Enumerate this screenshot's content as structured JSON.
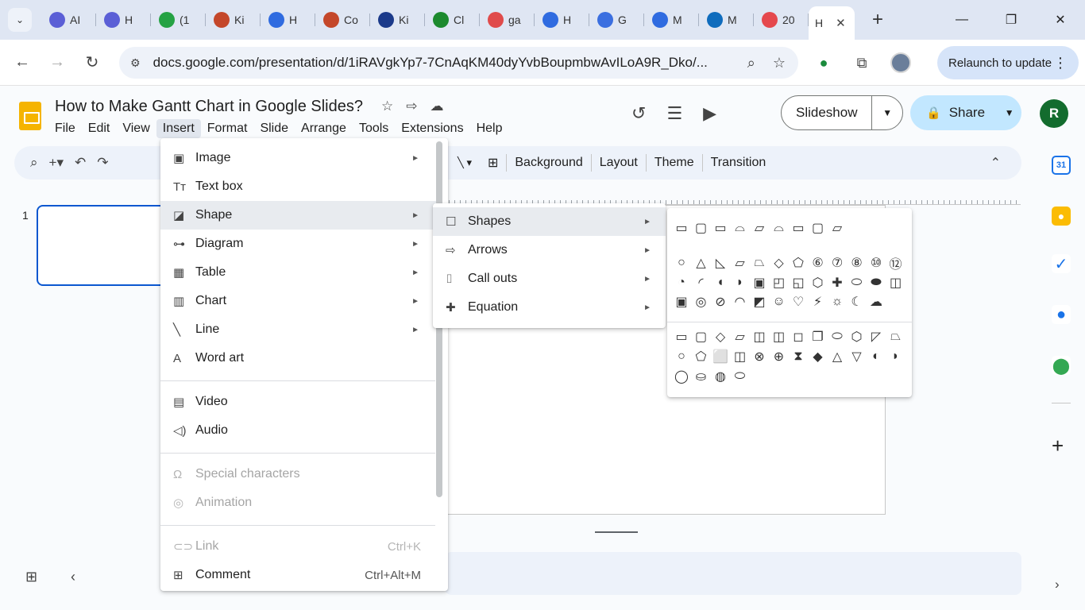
{
  "browser": {
    "tabs": [
      {
        "label": "AI",
        "icon": "purple-circle",
        "color": "#5b5fd6"
      },
      {
        "label": "H",
        "icon": "purple-circle",
        "color": "#5b5fd6"
      },
      {
        "label": "(1",
        "icon": "green-circle",
        "color": "#25a244"
      },
      {
        "label": "Ki",
        "icon": "powerpoint",
        "color": "#c4472a"
      },
      {
        "label": "H",
        "icon": "docs",
        "color": "#2f6be0"
      },
      {
        "label": "Co",
        "icon": "powerpoint",
        "color": "#c4472a"
      },
      {
        "label": "Ki",
        "icon": "wps",
        "color": "#1b3a8a"
      },
      {
        "label": "Cl",
        "icon": "check",
        "color": "#1c8a2e"
      },
      {
        "label": "ga",
        "icon": "red-square",
        "color": "#e04b4b"
      },
      {
        "label": "H",
        "icon": "docs",
        "color": "#2f6be0"
      },
      {
        "label": "G",
        "icon": "gemini",
        "color": "#3b6fe0"
      },
      {
        "label": "M",
        "icon": "docs",
        "color": "#2f6be0"
      },
      {
        "label": "M",
        "icon": "outlook",
        "color": "#0f6cbd"
      },
      {
        "label": "20",
        "icon": "clickup",
        "color": "#e5484d"
      }
    ],
    "active_tab": {
      "label": "H"
    },
    "url": "docs.google.com/presentation/d/1iRAVgkYp7-7CnAqKM40dyYvbBoupmbwAvILoA9R_Dko/...",
    "relaunch_label": "Relaunch to update"
  },
  "doc": {
    "title": "How to Make Gantt Chart in Google Slides?",
    "menu": [
      "File",
      "Edit",
      "View",
      "Insert",
      "Format",
      "Slide",
      "Arrange",
      "Tools",
      "Extensions",
      "Help"
    ],
    "active_menu": "Insert",
    "slideshow_label": "Slideshow",
    "share_label": "Share",
    "user_initial": "R",
    "slide_number": "1"
  },
  "toolbar": {
    "buttons": [
      "Background",
      "Layout",
      "Theme",
      "Transition"
    ]
  },
  "insert_menu": {
    "items": [
      {
        "label": "Image",
        "icon": "image-icon",
        "glyph": "▣",
        "submenu": true
      },
      {
        "label": "Text box",
        "icon": "text-box-icon",
        "glyph": "Tт",
        "submenu": false
      },
      {
        "label": "Shape",
        "icon": "shape-icon",
        "glyph": "◪",
        "submenu": true,
        "highlighted": true
      },
      {
        "label": "Diagram",
        "icon": "diagram-icon",
        "glyph": "⊶",
        "submenu": true
      },
      {
        "label": "Table",
        "icon": "table-icon",
        "glyph": "▦",
        "submenu": true
      },
      {
        "label": "Chart",
        "icon": "chart-icon",
        "glyph": "▥",
        "submenu": true
      },
      {
        "label": "Line",
        "icon": "line-icon",
        "glyph": "╲",
        "submenu": true
      },
      {
        "label": "Word art",
        "icon": "word-art-icon",
        "glyph": "A",
        "submenu": false
      },
      {
        "label": "Video",
        "icon": "video-icon",
        "glyph": "▤",
        "submenu": false
      },
      {
        "label": "Audio",
        "icon": "audio-icon",
        "glyph": "◁)",
        "submenu": false
      },
      {
        "label": "Special characters",
        "icon": "omega-icon",
        "glyph": "Ω",
        "disabled": true
      },
      {
        "label": "Animation",
        "icon": "animation-icon",
        "glyph": "◎",
        "disabled": true
      },
      {
        "label": "Link",
        "icon": "link-icon",
        "glyph": "⊂⊃",
        "disabled": true,
        "shortcut": "Ctrl+K"
      },
      {
        "label": "Comment",
        "icon": "comment-icon",
        "glyph": "⊞",
        "shortcut": "Ctrl+Alt+M"
      }
    ]
  },
  "shape_submenu": {
    "items": [
      {
        "label": "Shapes",
        "icon": "square-icon",
        "glyph": "☐",
        "highlighted": true
      },
      {
        "label": "Arrows",
        "icon": "arrow-icon",
        "glyph": "⇨"
      },
      {
        "label": "Call outs",
        "icon": "callout-icon",
        "glyph": "⌷"
      },
      {
        "label": "Equation",
        "icon": "plus-outline-icon",
        "glyph": "✚"
      }
    ]
  },
  "shapes_grid": {
    "rows": [
      [
        "▭",
        "▢",
        "▭",
        "⌓",
        "▱",
        "⌓",
        "▭",
        "▢",
        "▱"
      ],
      [
        "○",
        "△",
        "◺",
        "▱",
        "⏢",
        "◇",
        "⬠",
        "⑥",
        "⑦",
        "⑧",
        "⑩",
        "⑫"
      ],
      [
        "◔",
        "◜",
        "◖",
        "◗",
        "▣",
        "◰",
        "◱",
        "⬡",
        "✚",
        "⬭",
        "⬬",
        "◫"
      ],
      [
        "▣",
        "◎",
        "⊘",
        "◠",
        "◩",
        "☺",
        "♡",
        "⚡",
        "☼",
        "☾",
        "☁"
      ],
      [
        "▭",
        "▢",
        "◇",
        "▱",
        "◫",
        "◫",
        "◻",
        "❐",
        "⬭",
        "⬡",
        "◸",
        "⏢"
      ],
      [
        "○",
        "⬠",
        "⬜",
        "◫",
        "⊗",
        "⊕",
        "⧗",
        "◆",
        "△",
        "▽",
        "◐",
        "◗"
      ],
      [
        "◯",
        "⛀",
        "◍",
        "⬭"
      ]
    ]
  }
}
